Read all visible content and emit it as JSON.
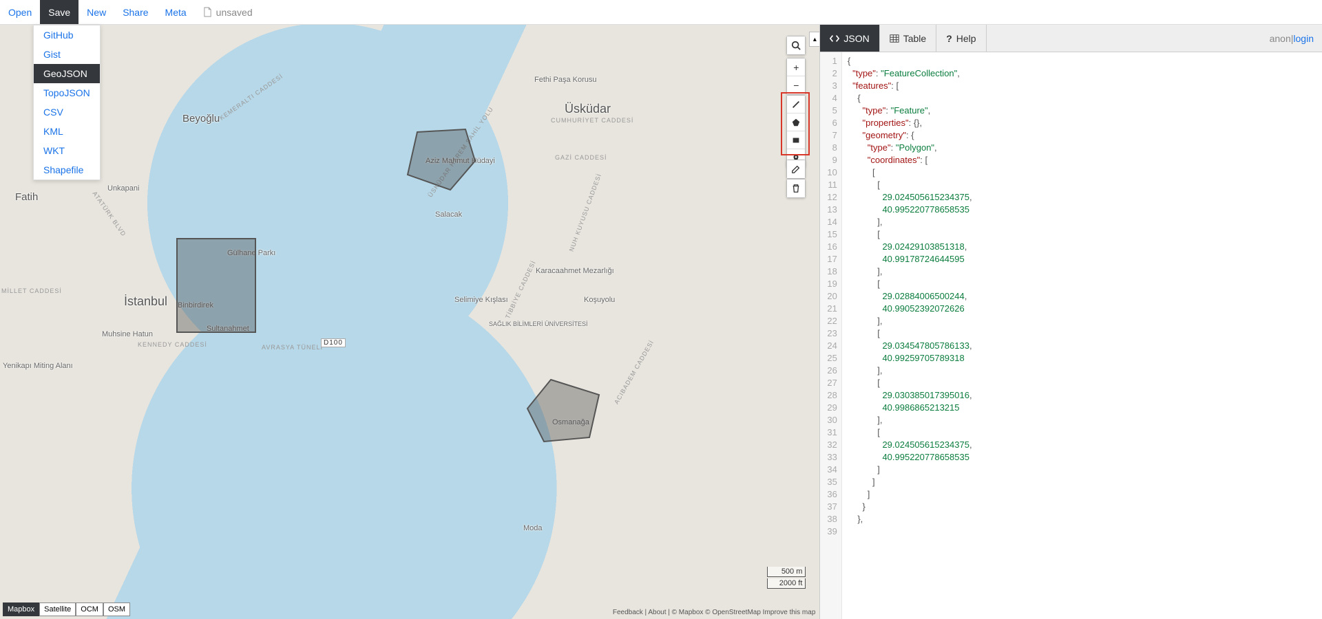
{
  "menu": {
    "items": [
      "Open",
      "Save",
      "New",
      "Share",
      "Meta"
    ],
    "active_index": 1,
    "file_status": "unsaved"
  },
  "save_dropdown": {
    "items": [
      "GitHub",
      "Gist",
      "GeoJSON",
      "TopoJSON",
      "CSV",
      "KML",
      "WKT",
      "Shapefile"
    ],
    "active_index": 2
  },
  "map": {
    "labels": {
      "istanbul": "İstanbul",
      "beyoglu": "Beyoğlu",
      "fatih": "Fatih",
      "uskudar": "Üsküdar",
      "binbirdirek": "Binbirdirek",
      "sultanahmet": "Sultanahmet",
      "gulhane": "Gülhane Parkı",
      "unkapani": "Unkapani",
      "salacak": "Salacak",
      "aziz": "Aziz Mahmut\nHüdayi",
      "osmanaga": "Osmanağa",
      "fethipasa": "Fethi Paşa\nKorusu",
      "selimiye": "Selimiye Kışlası",
      "karacaahmet": "Karacaahmet\nMezarlığı",
      "kosuyolu": "Koşuyolu",
      "saglik": "SAĞLIK\nBİLİMLERİ\nÜNİVERSİTESİ",
      "muhsine": "Muhsine\nHatun",
      "yenikapi": "Yenikapı Miting\nAlanı",
      "moda": "Moda"
    },
    "roads": {
      "kennedy": "KENNEDY CADDESİ",
      "avrasya": "AVRASYA TÜNELİ",
      "d100": "D100",
      "cumhuriyet": "CUMHURİYET CADDESİ",
      "gazi": "GAZİ CADDESİ",
      "nuh": "NUH KUYUSU CADDESİ",
      "tibbiye": "TİBBİYE CADDESİ",
      "acibadem": "ACIBADEM CADDESİ",
      "millet": "MİLLET CADDESİ",
      "ataturk": "ATATÜRK BLVD",
      "kemeralti": "KEMERALTI CADDESİ",
      "sahil": "ÜSKÜDAR HAREM SAHİL YOLU"
    },
    "scale": {
      "metric": "500 m",
      "imperial": "2000 ft"
    },
    "basemaps": [
      "Mapbox",
      "Satellite",
      "OCM",
      "OSM"
    ],
    "basemap_active": 0,
    "attribution": "Feedback | About | © Mapbox © OpenStreetMap Improve this map",
    "tools": {
      "search": "search-icon",
      "zoom_in": "+",
      "zoom_out": "−",
      "line": "draw-line-icon",
      "polygon": "draw-polygon-icon",
      "rect": "draw-rectangle-icon",
      "marker": "draw-marker-icon",
      "edit": "edit-icon",
      "trash": "trash-icon"
    }
  },
  "right_panel": {
    "tabs": [
      {
        "icon": "code-icon",
        "label": "JSON"
      },
      {
        "icon": "table-icon",
        "label": "Table"
      },
      {
        "icon": "help-icon",
        "label": "Help"
      }
    ],
    "active_tab": 0,
    "auth": {
      "anon": "anon",
      "sep": " | ",
      "login": "login"
    }
  },
  "chart_data": {
    "type": "geojson",
    "geojson": {
      "type": "FeatureCollection",
      "features": [
        {
          "type": "Feature",
          "properties": {},
          "geometry": {
            "type": "Polygon",
            "coordinates": [
              [
                [
                  29.024505615234375,
                  40.995220778658535
                ],
                [
                  29.02429103851318,
                  40.99178724644595
                ],
                [
                  29.02884006500244,
                  40.99052392072626
                ],
                [
                  29.034547805786133,
                  40.99259705789318
                ],
                [
                  29.030385017395016,
                  40.9986865213215
                ],
                [
                  29.024505615234375,
                  40.995220778658535
                ]
              ]
            ]
          }
        }
      ]
    }
  },
  "editor": {
    "lines": [
      {
        "n": 1,
        "t": "{"
      },
      {
        "n": 2,
        "t": "  \"type\": \"FeatureCollection\","
      },
      {
        "n": 3,
        "t": "  \"features\": ["
      },
      {
        "n": 4,
        "t": "    {"
      },
      {
        "n": 5,
        "t": "      \"type\": \"Feature\","
      },
      {
        "n": 6,
        "t": "      \"properties\": {},"
      },
      {
        "n": 7,
        "t": "      \"geometry\": {"
      },
      {
        "n": 8,
        "t": "        \"type\": \"Polygon\","
      },
      {
        "n": 9,
        "t": "        \"coordinates\": ["
      },
      {
        "n": 10,
        "t": "          ["
      },
      {
        "n": 11,
        "t": "            ["
      },
      {
        "n": 12,
        "t": "              29.024505615234375,"
      },
      {
        "n": 13,
        "t": "              40.995220778658535"
      },
      {
        "n": 14,
        "t": "            ],"
      },
      {
        "n": 15,
        "t": "            ["
      },
      {
        "n": 16,
        "t": "              29.02429103851318,"
      },
      {
        "n": 17,
        "t": "              40.99178724644595"
      },
      {
        "n": 18,
        "t": "            ],"
      },
      {
        "n": 19,
        "t": "            ["
      },
      {
        "n": 20,
        "t": "              29.02884006500244,"
      },
      {
        "n": 21,
        "t": "              40.99052392072626"
      },
      {
        "n": 22,
        "t": "            ],"
      },
      {
        "n": 23,
        "t": "            ["
      },
      {
        "n": 24,
        "t": "              29.034547805786133,"
      },
      {
        "n": 25,
        "t": "              40.99259705789318"
      },
      {
        "n": 26,
        "t": "            ],"
      },
      {
        "n": 27,
        "t": "            ["
      },
      {
        "n": 28,
        "t": "              29.030385017395016,"
      },
      {
        "n": 29,
        "t": "              40.9986865213215"
      },
      {
        "n": 30,
        "t": "            ],"
      },
      {
        "n": 31,
        "t": "            ["
      },
      {
        "n": 32,
        "t": "              29.024505615234375,"
      },
      {
        "n": 33,
        "t": "              40.995220778658535"
      },
      {
        "n": 34,
        "t": "            ]"
      },
      {
        "n": 35,
        "t": "          ]"
      },
      {
        "n": 36,
        "t": "        ]"
      },
      {
        "n": 37,
        "t": "      }"
      },
      {
        "n": 38,
        "t": "    },"
      },
      {
        "n": 39,
        "t": ""
      }
    ]
  }
}
